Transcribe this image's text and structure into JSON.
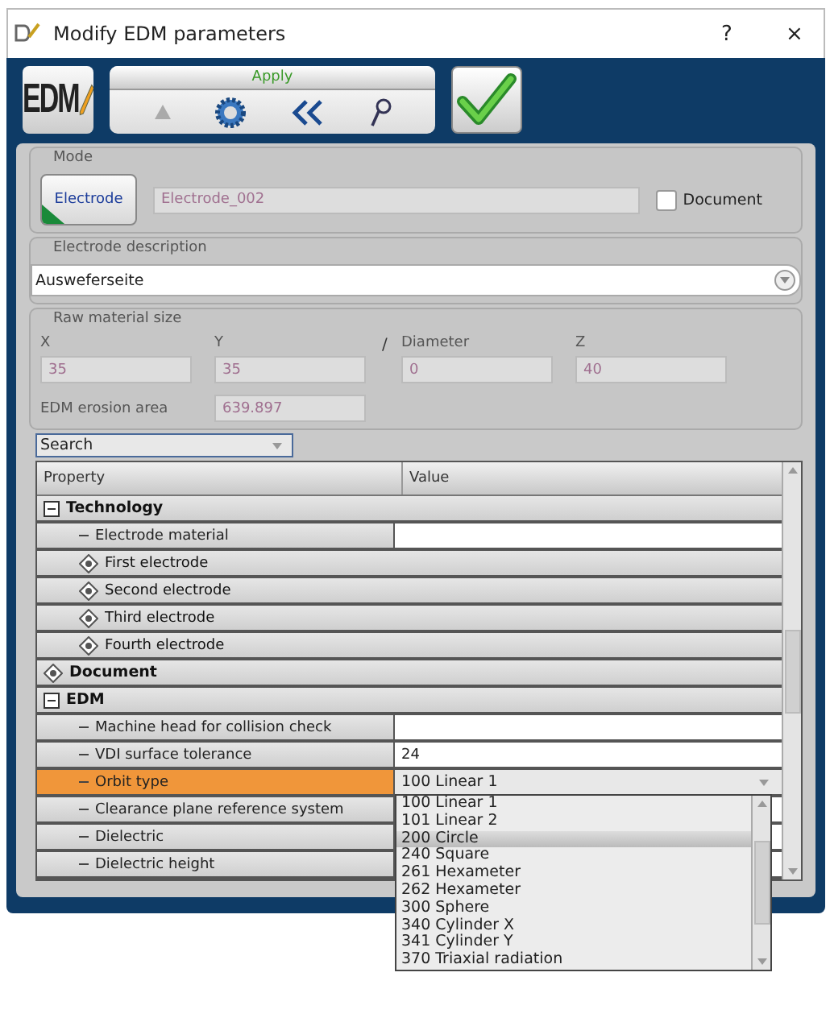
{
  "window": {
    "title": "Modify EDM parameters",
    "help": "?",
    "close": "×"
  },
  "toolbar": {
    "logo_text": "EDM",
    "apply_label": "Apply"
  },
  "mode": {
    "legend": "Mode",
    "button": "Electrode",
    "name_value": "Electrode_002",
    "document_label": "Document",
    "document_checked": false
  },
  "description": {
    "legend": "Electrode description",
    "value": "Ausweferseite"
  },
  "raw_material": {
    "legend": "Raw material size",
    "fields": [
      {
        "label": "X",
        "value": "35"
      },
      {
        "label": "Y",
        "value": "35"
      },
      {
        "label": "Diameter",
        "value": "0"
      },
      {
        "label": "Z",
        "value": "40"
      }
    ],
    "separator": "/",
    "erosion_label": "EDM erosion area",
    "erosion_value": "639.897"
  },
  "search": {
    "value": "Search"
  },
  "table": {
    "columns": [
      "Property",
      "Value"
    ],
    "rows": [
      {
        "label": "Technology",
        "kind": "group",
        "expanded": true,
        "selected": false,
        "children": [
          {
            "label": "Electrode material",
            "kind": "field",
            "selected": false
          },
          {
            "label": "First electrode",
            "kind": "group",
            "expanded": false,
            "selected": false
          },
          {
            "label": "Second electrode",
            "kind": "group",
            "expanded": false,
            "selected": false
          },
          {
            "label": "Third electrode",
            "kind": "group",
            "expanded": false,
            "selected": false
          },
          {
            "label": "Fourth electrode",
            "kind": "group",
            "expanded": false,
            "selected": false
          }
        ]
      },
      {
        "label": "Document",
        "kind": "group",
        "expanded": false,
        "selected": false
      },
      {
        "label": "EDM",
        "kind": "group",
        "expanded": true,
        "selected": false,
        "children": [
          {
            "label": "Machine head for collision check",
            "kind": "field",
            "selected": false
          },
          {
            "label": "VDI surface tolerance",
            "kind": "field",
            "value": "24",
            "selected": false
          },
          {
            "label": "Orbit type",
            "kind": "dropdown",
            "value": "100 Linear 1",
            "selected": true,
            "open": true,
            "options": [
              {
                "label": "100 Linear 1",
                "highlighted": false
              },
              {
                "label": "101 Linear 2",
                "highlighted": false
              },
              {
                "label": "200 Circle",
                "highlighted": true
              },
              {
                "label": "240 Square",
                "highlighted": false
              },
              {
                "label": "261 Hexameter",
                "highlighted": false
              },
              {
                "label": "262 Hexameter",
                "highlighted": false
              },
              {
                "label": "300 Sphere",
                "highlighted": false
              },
              {
                "label": "340 Cylinder X",
                "highlighted": false
              },
              {
                "label": "341 Cylinder Y",
                "highlighted": false
              },
              {
                "label": "370 Triaxial radiation",
                "highlighted": false
              }
            ]
          },
          {
            "label": "Clearance plane reference system",
            "kind": "field",
            "selected": false
          },
          {
            "label": "Dielectric",
            "kind": "field",
            "selected": false
          },
          {
            "label": "Dielectric height",
            "kind": "field",
            "selected": false
          }
        ]
      }
    ]
  }
}
